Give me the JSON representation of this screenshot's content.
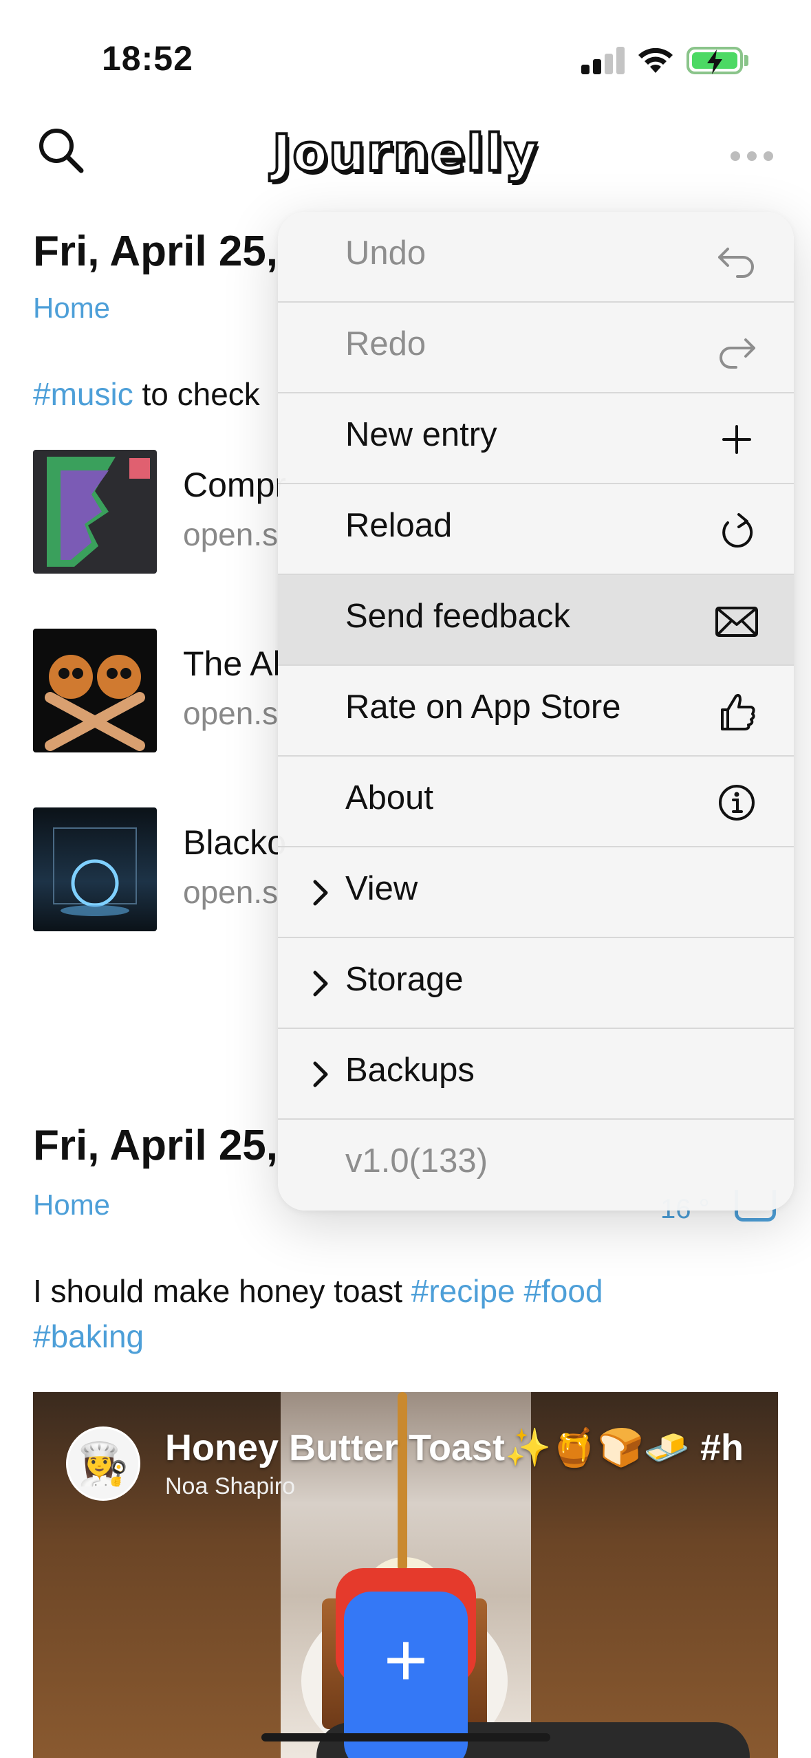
{
  "status_bar": {
    "time": "18:52"
  },
  "header": {
    "app_title": "Journelly"
  },
  "entries": [
    {
      "date": "Fri, April 25,",
      "location": "Home",
      "text_tag": "#music",
      "text_rest": " to check",
      "links": [
        {
          "title": "Compr",
          "url": "open.s"
        },
        {
          "title": "The Al",
          "url": "open.s"
        },
        {
          "title": "Blacko",
          "url": "open.s"
        }
      ]
    },
    {
      "date": "Fri, April 25,",
      "location": "Home",
      "side_meta": "16 °",
      "text_plain": "I should make honey toast ",
      "tag_recipe": "#recipe",
      "tag_food": "#food",
      "tag_baking": "#baking",
      "video": {
        "title": "Honey Butter Toast✨🍯🍞🧈 #h",
        "channel": "Noa Shapiro"
      }
    }
  ],
  "menu": {
    "items": [
      {
        "label": "Undo",
        "icon": "undo-icon",
        "disabled": true
      },
      {
        "label": "Redo",
        "icon": "redo-icon",
        "disabled": true
      },
      {
        "label": "New entry",
        "icon": "plus-icon"
      },
      {
        "label": "Reload",
        "icon": "reload-icon"
      },
      {
        "label": "Send feedback",
        "icon": "envelope-icon",
        "highlighted": true
      },
      {
        "label": "Rate on App Store",
        "icon": "thumbs-up-icon"
      },
      {
        "label": "About",
        "icon": "info-icon"
      },
      {
        "label": "View",
        "submenu": true
      },
      {
        "label": "Storage",
        "submenu": true
      },
      {
        "label": "Backups",
        "submenu": true
      },
      {
        "label": "v1.0(133)",
        "disabled": true
      }
    ]
  },
  "fab": {
    "label": "+"
  },
  "colors": {
    "accent": "#4d9fd8",
    "fab": "#3478f6",
    "highlight": "#e1e1e1"
  }
}
